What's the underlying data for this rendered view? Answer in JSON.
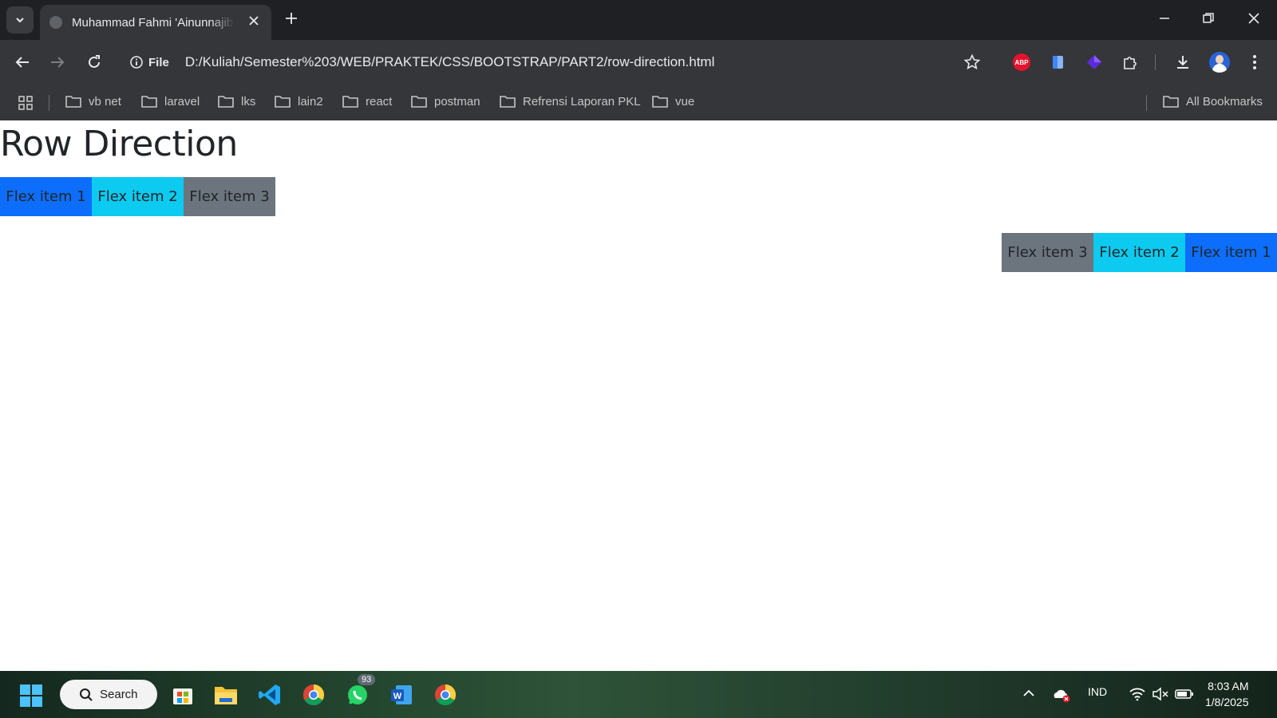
{
  "browser": {
    "tab": {
      "title": "Muhammad Fahmi 'Ainunnajib"
    },
    "address": {
      "scheme_label": "File",
      "url": "D:/Kuliah/Semester%203/WEB/PRAKTEK/CSS/BOOTSTRAP/PART2/row-direction.html"
    },
    "extensions": [
      "ABP"
    ],
    "bookmarks": [
      "vb net",
      "laravel",
      "lks",
      "lain2",
      "react",
      "postman",
      "Refrensi Laporan PKL",
      "vue"
    ],
    "all_bookmarks_label": "All Bookmarks"
  },
  "page": {
    "heading": "Row Direction",
    "row1": [
      "Flex item 1",
      "Flex item 2",
      "Flex item 3"
    ],
    "row2": [
      "Flex item 3",
      "Flex item 2",
      "Flex item 1"
    ],
    "colors": {
      "primary": "#0d6efd",
      "info": "#0dcaf0",
      "secondary": "#6c757d"
    }
  },
  "taskbar": {
    "search_label": "Search",
    "whatsapp_badge": "93",
    "language": "IND",
    "time": "8:03 AM",
    "date": "1/8/2025"
  }
}
